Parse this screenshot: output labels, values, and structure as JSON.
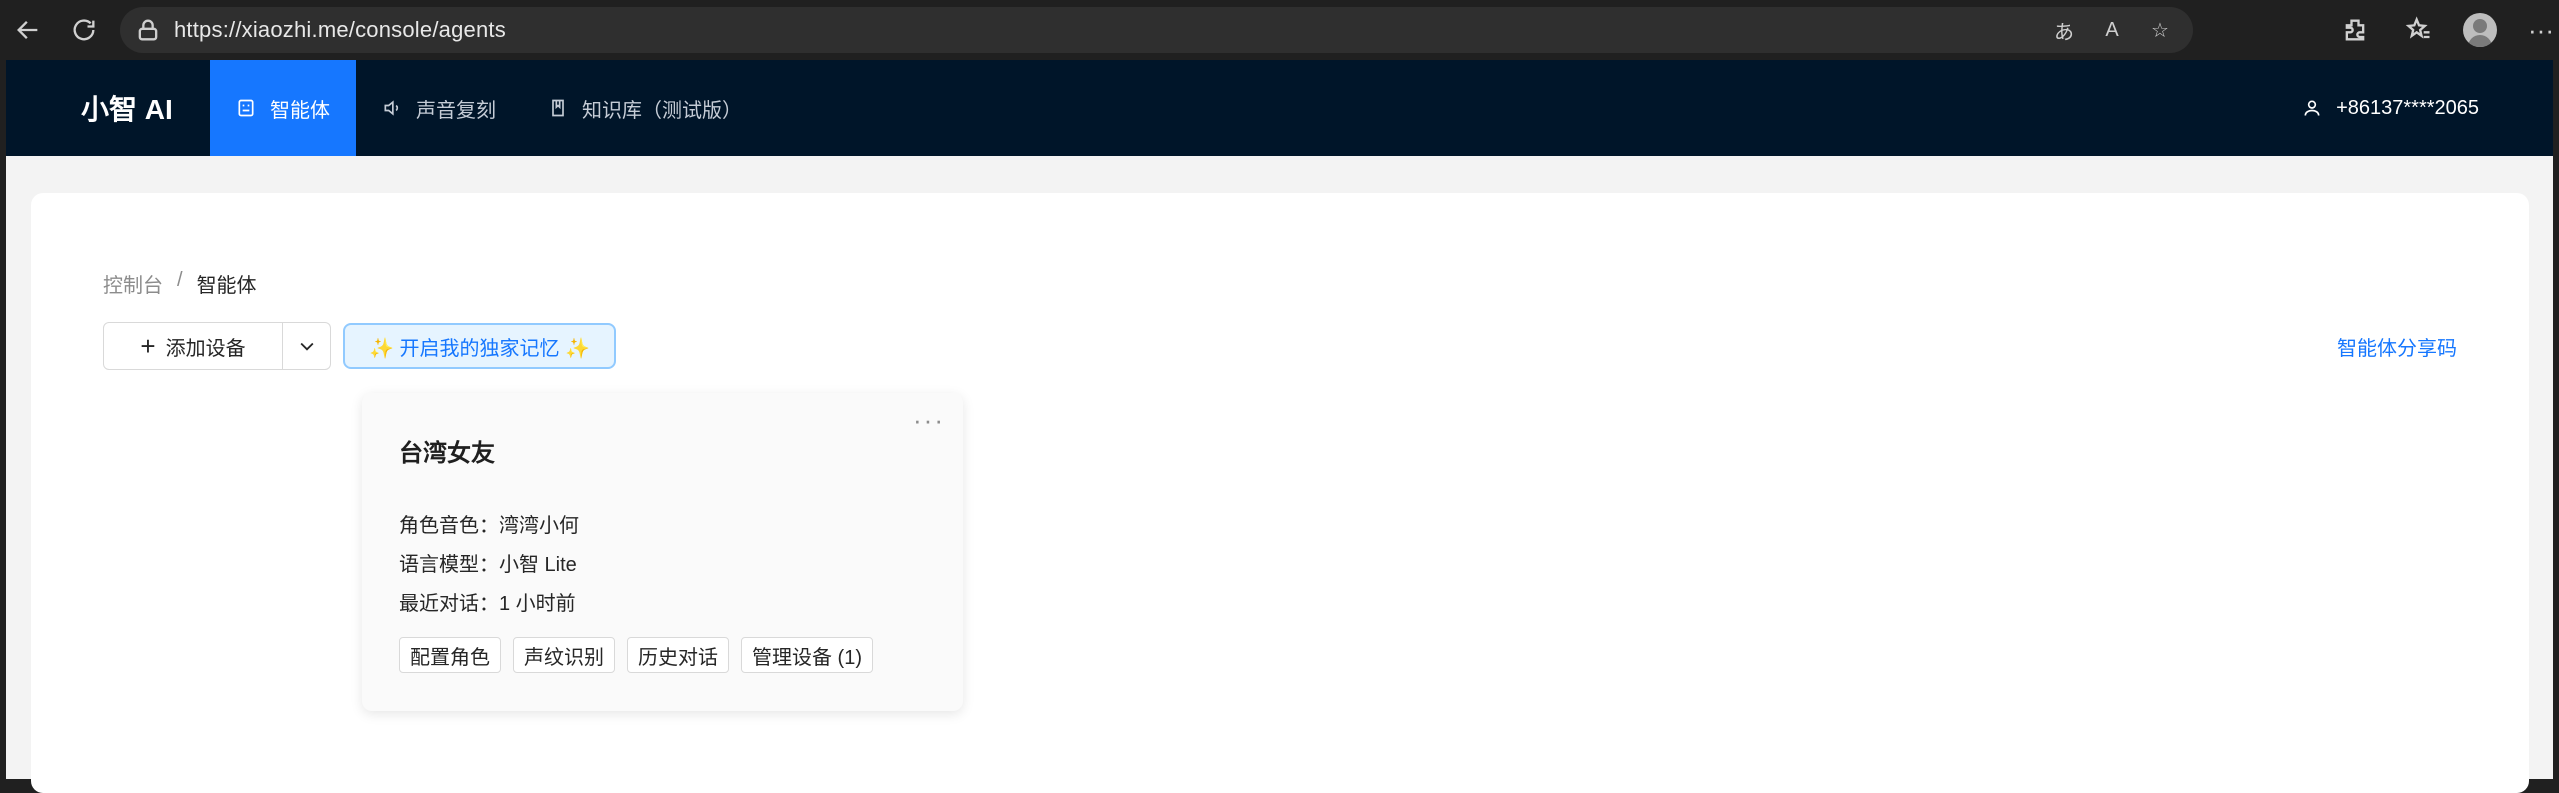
{
  "browser": {
    "url": "https://xiaozhi.me/console/agents"
  },
  "app": {
    "brand": "小智 AI",
    "nav": [
      {
        "label": "智能体",
        "icon": "robot-icon",
        "active": true
      },
      {
        "label": "声音复刻",
        "icon": "speaker-icon",
        "active": false
      },
      {
        "label": "知识库（测试版）",
        "icon": "book-icon",
        "active": false
      }
    ],
    "user": "+86137****2065",
    "accent": "#1677ff",
    "nav_bg": "#001529"
  },
  "breadcrumb": {
    "root": "控制台",
    "separator": "/",
    "current": "智能体"
  },
  "actions": {
    "add_device": "添加设备",
    "add_icon": "plus-icon",
    "memory_button": "✨ 开启我的独家记忆 ✨",
    "share_code": "智能体分享码"
  },
  "agent": {
    "name": "台湾女友",
    "more": "···",
    "voice_label": "角色音色：",
    "voice": "湾湾小何",
    "model_label": "语言模型：",
    "model": "小智 Lite",
    "last_label": "最近对话：",
    "last": "1 小时前",
    "buttons": [
      "配置角色",
      "声纹识别",
      "历史对话",
      "管理设备 (1)"
    ]
  }
}
